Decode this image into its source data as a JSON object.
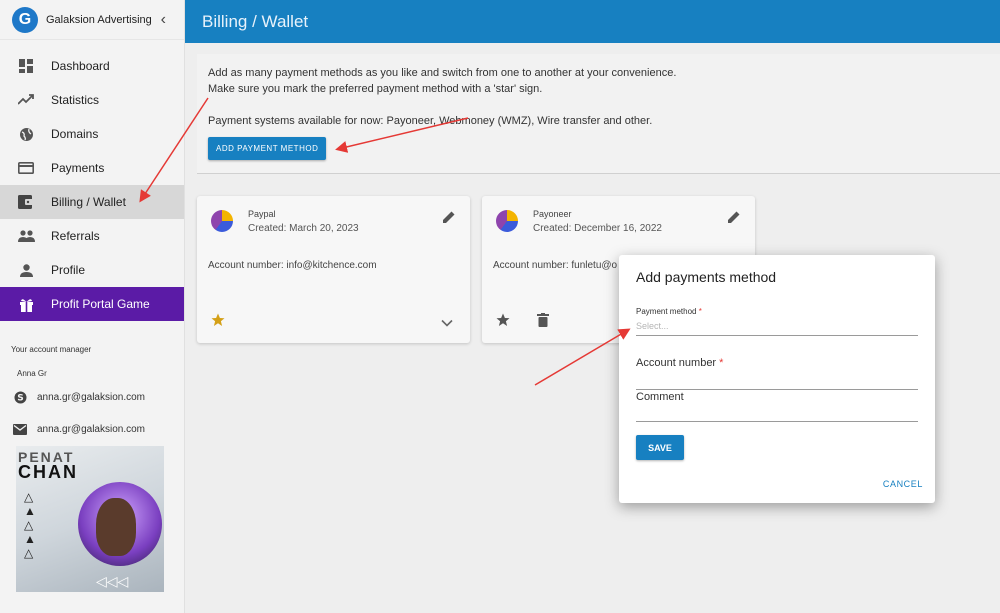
{
  "brand": {
    "name": "Galaksion Advertising",
    "logo_letter": "G"
  },
  "nav": {
    "items": [
      {
        "label": "Dashboard",
        "icon": "dashboard-icon"
      },
      {
        "label": "Statistics",
        "icon": "trending-up-icon"
      },
      {
        "label": "Domains",
        "icon": "globe-icon"
      },
      {
        "label": "Payments",
        "icon": "credit-card-icon"
      },
      {
        "label": "Billing / Wallet",
        "icon": "wallet-icon",
        "active": true
      },
      {
        "label": "Referrals",
        "icon": "people-icon"
      },
      {
        "label": "Profile",
        "icon": "person-icon"
      },
      {
        "label": "Profit Portal Game",
        "icon": "gift-icon",
        "promo": true
      }
    ]
  },
  "account_manager": {
    "title": "Your account manager",
    "name": "Anna Gr",
    "skype": "anna.gr@galaksion.com",
    "email": "anna.gr@galaksion.com"
  },
  "promo": {
    "line1": "PENAT",
    "line2": "CHAN"
  },
  "header": {
    "title": "Billing / Wallet"
  },
  "info": {
    "line1": "Add as many payment methods as you like and switch from one to another at your convenience.",
    "line2": "Make sure you mark the preferred payment method with a 'star' sign.",
    "line3": "Payment systems available for now: Payoneer, Webmoney (WMZ), Wire transfer and other.",
    "add_button": "ADD PAYMENT METHOD"
  },
  "cards": [
    {
      "name": "Paypal",
      "created": "Created: March 20, 2023",
      "account": "Account number: info@kitchence.com",
      "preferred": true
    },
    {
      "name": "Payoneer",
      "created": "Created: December 16, 2022",
      "account": "Account number: funletu@o",
      "preferred": false
    }
  ],
  "modal": {
    "title": "Add payments method",
    "payment_method_label": "Payment method",
    "payment_method_placeholder": "Select...",
    "account_number_label": "Account number",
    "comment_label": "Comment",
    "required_mark": "*",
    "save_label": "SAVE",
    "cancel_label": "CANCEL"
  },
  "colors": {
    "accent": "#1780c1",
    "promo": "#5b1ba6",
    "star": "#d4a017",
    "arrow": "#e53935"
  }
}
